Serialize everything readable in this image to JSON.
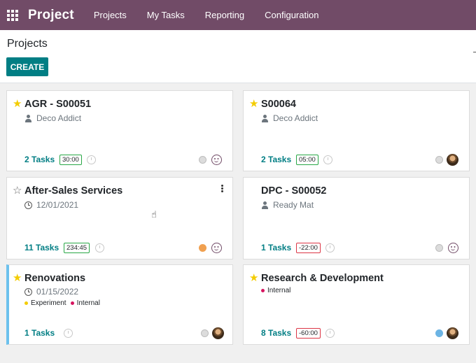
{
  "navbar": {
    "app_title": "Project",
    "menu": [
      "Projects",
      "My Tasks",
      "Reporting",
      "Configuration"
    ]
  },
  "control": {
    "breadcrumb": "Projects",
    "create_label": "CREATE"
  },
  "cards": [
    {
      "title": "AGR - S00051",
      "favorite": true,
      "sub_icon": "person-icon",
      "sub_text": "Deco Addict",
      "tasks": "2 Tasks",
      "hours": "30:00",
      "hours_state": "positive",
      "status_color": "grey",
      "avatar": "smiley-placeholder"
    },
    {
      "title": "S00064",
      "favorite": true,
      "sub_icon": "person-icon",
      "sub_text": "Deco Addict",
      "tasks": "2 Tasks",
      "hours": "05:00",
      "hours_state": "positive",
      "status_color": "grey",
      "avatar": "user-photo"
    },
    {
      "title": "After-Sales Services",
      "favorite": false,
      "sub_icon": "clock-icon",
      "sub_text": "12/01/2021",
      "tasks": "11 Tasks",
      "hours": "234:45",
      "hours_state": "positive",
      "status_color": "orange",
      "avatar": "smiley-placeholder"
    },
    {
      "title": "DPC - S00052",
      "favorite": null,
      "sub_icon": "person-icon",
      "sub_text": "Ready Mat",
      "tasks": "1 Tasks",
      "hours": "-22:00",
      "hours_state": "negative",
      "status_color": "grey",
      "avatar": "smiley-placeholder"
    },
    {
      "title": "Renovations",
      "favorite": true,
      "sub_icon": "clock-icon",
      "sub_text": "01/15/2022",
      "tags": [
        {
          "label": "Experiment",
          "color": "#f3cc00"
        },
        {
          "label": "Internal",
          "color": "#d6145f"
        }
      ],
      "tasks": "1 Tasks",
      "status_color": "grey",
      "avatar": "user-photo",
      "accent_color": "#6cc1ed"
    },
    {
      "title": "Research & Development",
      "favorite": true,
      "tags": [
        {
          "label": "Internal",
          "color": "#d6145f"
        }
      ],
      "tasks": "8 Tasks",
      "hours": "-60:00",
      "hours_state": "negative",
      "status_color": "blue",
      "avatar": "user-photo"
    }
  ],
  "colors": {
    "navbar": "#714b67",
    "primary": "#017e84",
    "star": "#f3cc00"
  }
}
